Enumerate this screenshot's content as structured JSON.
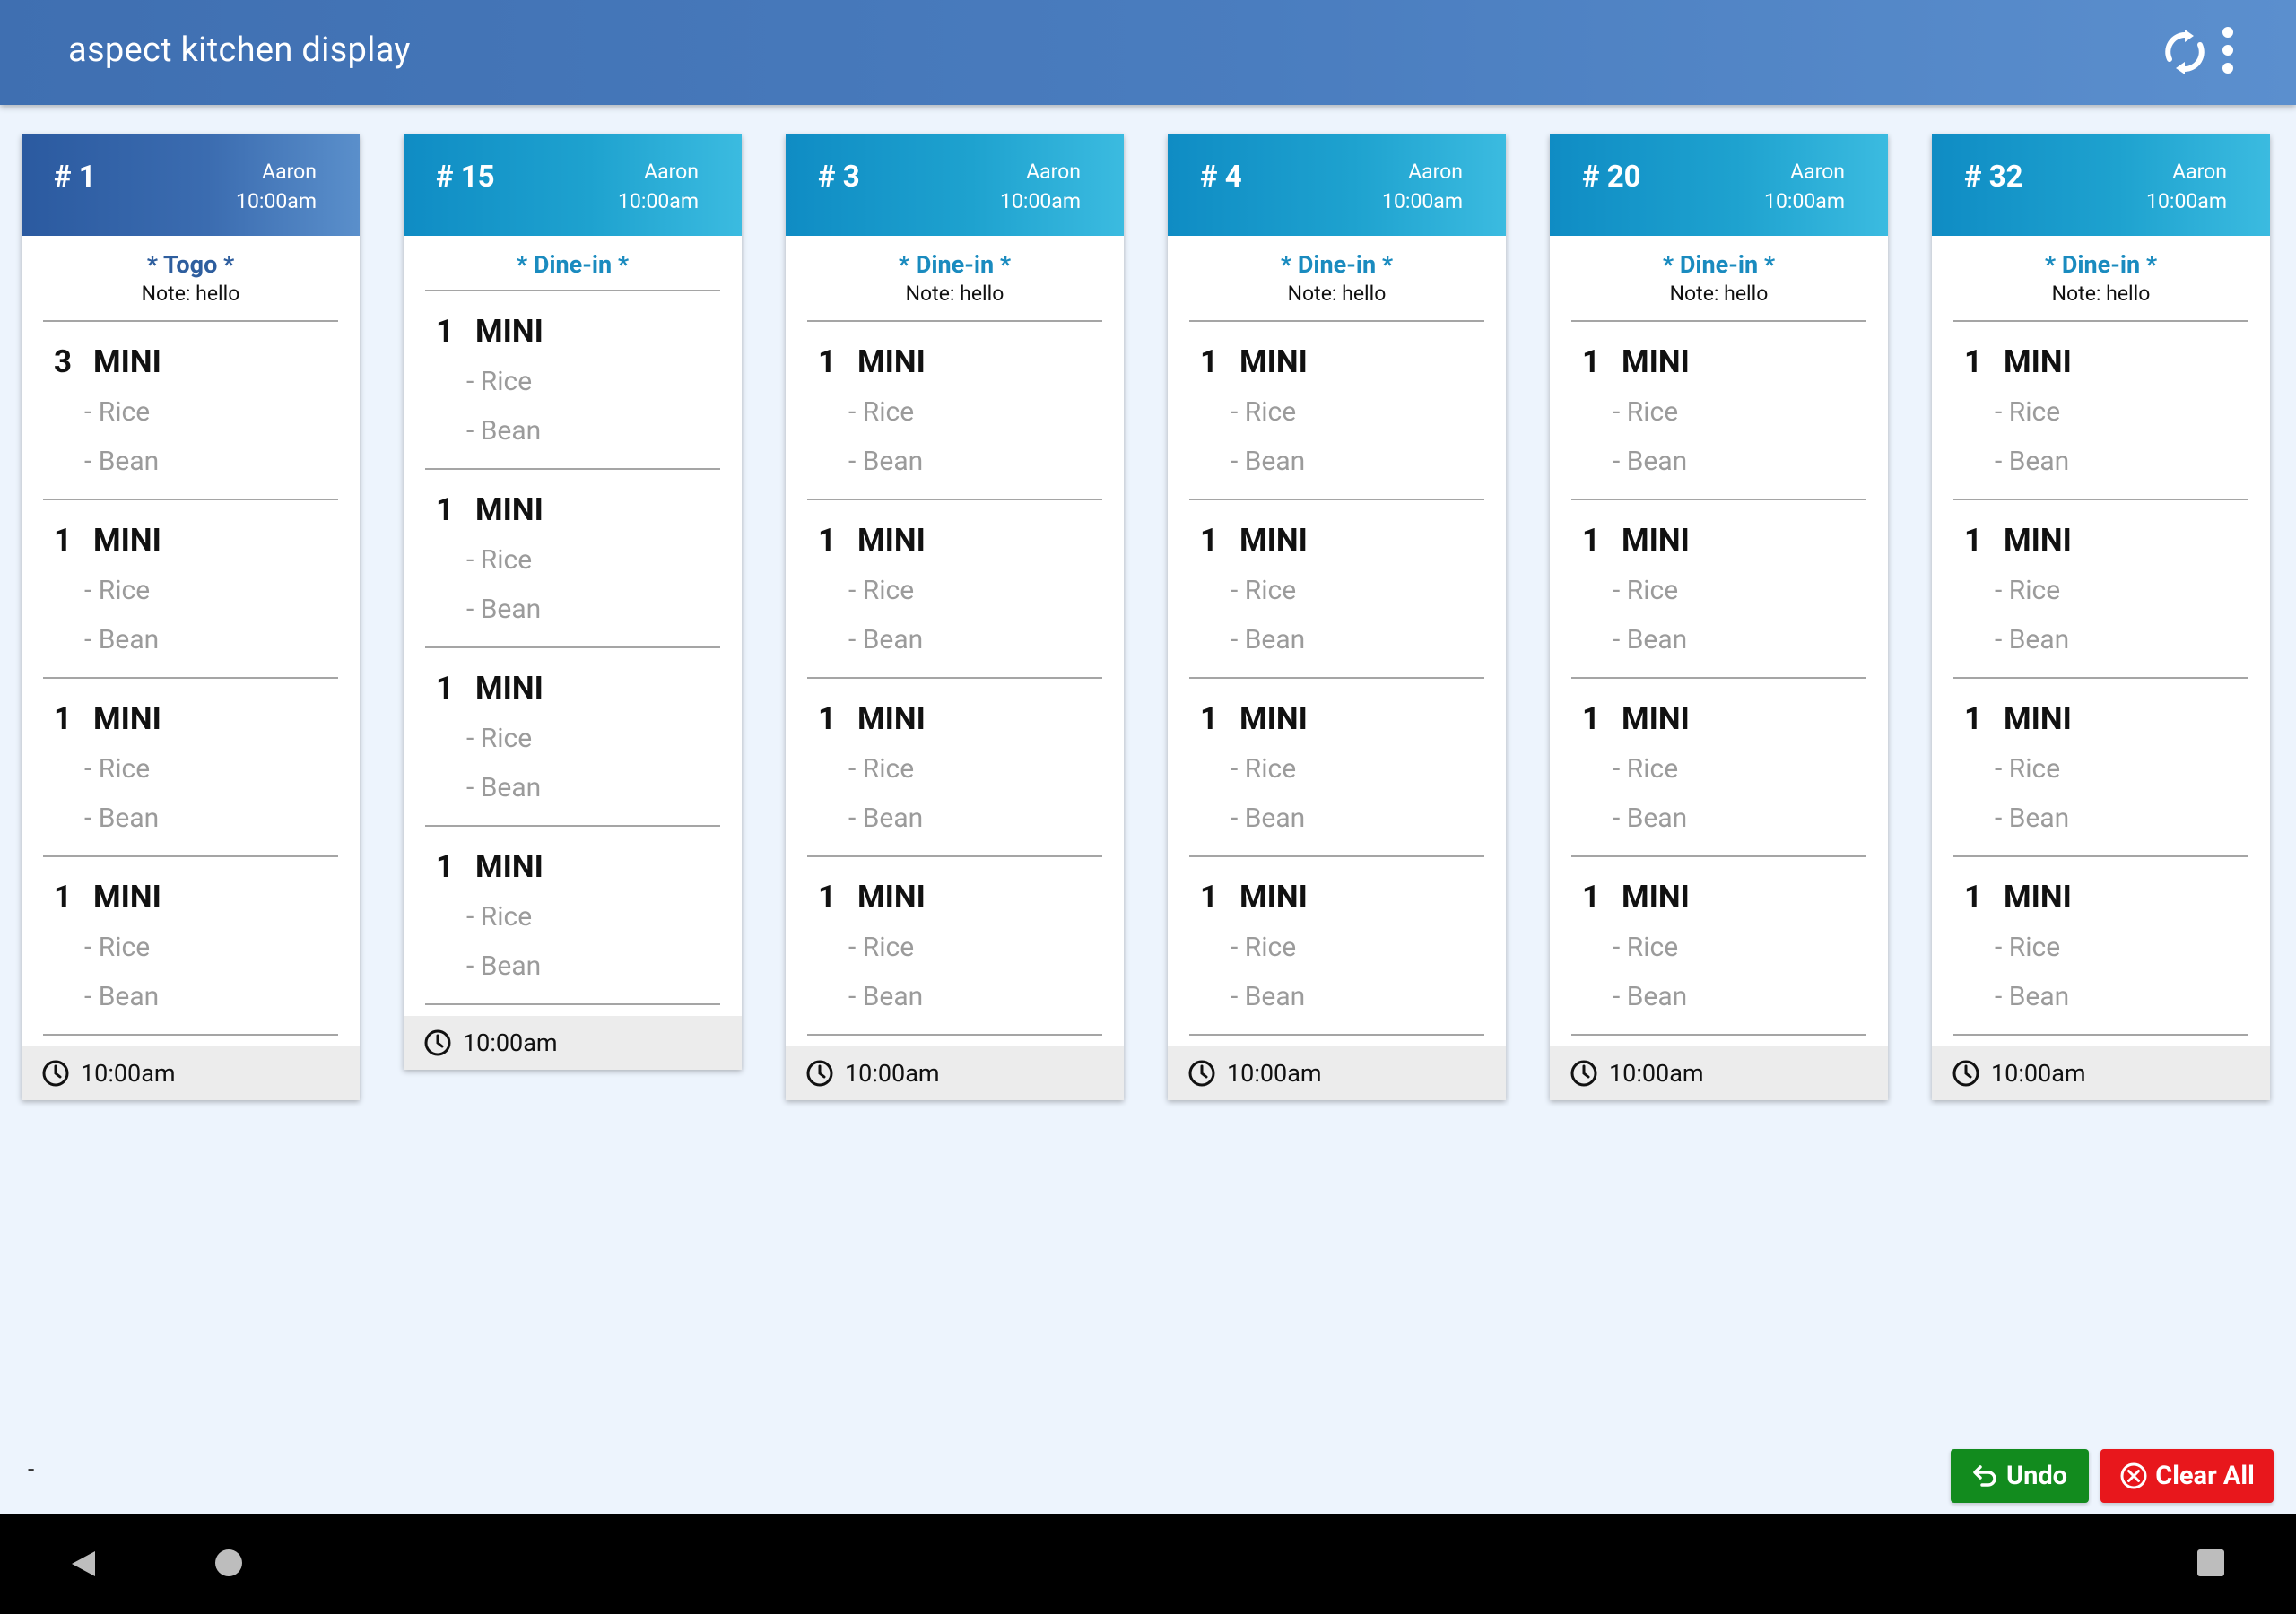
{
  "app": {
    "title": "aspect kitchen display"
  },
  "colors": {
    "appbar": "#4a7dbf",
    "ticket_header": "#1ea2cf",
    "first_ticket_header": "#3b6cb0",
    "undo": "#128b1e",
    "clear_all": "#e8171c"
  },
  "tickets": [
    {
      "number": "# 1",
      "server": "Aaron",
      "time": "10:00am",
      "type": "* Togo *",
      "note": "Note: hello",
      "footer_time": "10:00am",
      "items": [
        {
          "qty": "3",
          "name": "MINI",
          "mods": [
            "- Rice",
            "- Bean"
          ]
        },
        {
          "qty": "1",
          "name": "MINI",
          "mods": [
            "- Rice",
            "- Bean"
          ]
        },
        {
          "qty": "1",
          "name": "MINI",
          "mods": [
            "- Rice",
            "- Bean"
          ]
        },
        {
          "qty": "1",
          "name": "MINI",
          "mods": [
            "- Rice",
            "- Bean"
          ]
        }
      ]
    },
    {
      "number": "# 15",
      "server": "Aaron",
      "time": "10:00am",
      "type": "* Dine-in *",
      "note": "",
      "footer_time": "10:00am",
      "items": [
        {
          "qty": "1",
          "name": "MINI",
          "mods": [
            "- Rice",
            "- Bean"
          ]
        },
        {
          "qty": "1",
          "name": "MINI",
          "mods": [
            "- Rice",
            "- Bean"
          ]
        },
        {
          "qty": "1",
          "name": "MINI",
          "mods": [
            "- Rice",
            "- Bean"
          ]
        },
        {
          "qty": "1",
          "name": "MINI",
          "mods": [
            "- Rice",
            "- Bean"
          ]
        }
      ]
    },
    {
      "number": "# 3",
      "server": "Aaron",
      "time": "10:00am",
      "type": "* Dine-in *",
      "note": "Note: hello",
      "footer_time": "10:00am",
      "items": [
        {
          "qty": "1",
          "name": "MINI",
          "mods": [
            "- Rice",
            "- Bean"
          ]
        },
        {
          "qty": "1",
          "name": "MINI",
          "mods": [
            "- Rice",
            "- Bean"
          ]
        },
        {
          "qty": "1",
          "name": "MINI",
          "mods": [
            "- Rice",
            "- Bean"
          ]
        },
        {
          "qty": "1",
          "name": "MINI",
          "mods": [
            "- Rice",
            "- Bean"
          ]
        }
      ]
    },
    {
      "number": "# 4",
      "server": "Aaron",
      "time": "10:00am",
      "type": "* Dine-in *",
      "note": "Note: hello",
      "footer_time": "10:00am",
      "items": [
        {
          "qty": "1",
          "name": "MINI",
          "mods": [
            "- Rice",
            "- Bean"
          ]
        },
        {
          "qty": "1",
          "name": "MINI",
          "mods": [
            "- Rice",
            "- Bean"
          ]
        },
        {
          "qty": "1",
          "name": "MINI",
          "mods": [
            "- Rice",
            "- Bean"
          ]
        },
        {
          "qty": "1",
          "name": "MINI",
          "mods": [
            "- Rice",
            "- Bean"
          ]
        }
      ]
    },
    {
      "number": "# 20",
      "server": "Aaron",
      "time": "10:00am",
      "type": "* Dine-in *",
      "note": "Note: hello",
      "footer_time": "10:00am",
      "items": [
        {
          "qty": "1",
          "name": "MINI",
          "mods": [
            "- Rice",
            "- Bean"
          ]
        },
        {
          "qty": "1",
          "name": "MINI",
          "mods": [
            "- Rice",
            "- Bean"
          ]
        },
        {
          "qty": "1",
          "name": "MINI",
          "mods": [
            "- Rice",
            "- Bean"
          ]
        },
        {
          "qty": "1",
          "name": "MINI",
          "mods": [
            "- Rice",
            "- Bean"
          ]
        }
      ]
    },
    {
      "number": "# 32",
      "server": "Aaron",
      "time": "10:00am",
      "type": "* Dine-in *",
      "note": "Note: hello",
      "footer_time": "10:00am",
      "items": [
        {
          "qty": "1",
          "name": "MINI",
          "mods": [
            "- Rice",
            "- Bean"
          ]
        },
        {
          "qty": "1",
          "name": "MINI",
          "mods": [
            "- Rice",
            "- Bean"
          ]
        },
        {
          "qty": "1",
          "name": "MINI",
          "mods": [
            "- Rice",
            "- Bean"
          ]
        },
        {
          "qty": "1",
          "name": "MINI",
          "mods": [
            "- Rice",
            "- Bean"
          ]
        }
      ]
    }
  ],
  "footer": {
    "status": "-",
    "undo_label": "Undo",
    "clear_label": "Clear All"
  },
  "icons": {
    "refresh": "refresh-icon",
    "more": "more-vert-icon",
    "clock": "clock-icon",
    "undo": "undo-icon",
    "clear": "cancel-circle-icon"
  }
}
